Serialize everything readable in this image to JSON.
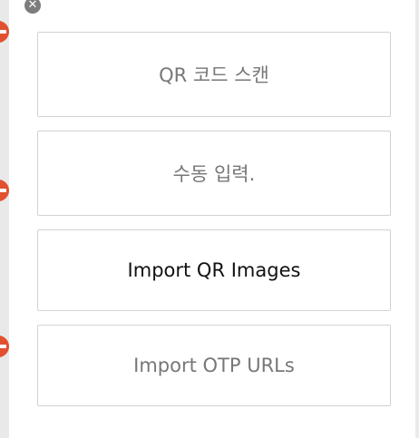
{
  "popup": {
    "close_icon": "close-icon",
    "menu": [
      {
        "label": "QR 코드 스캔",
        "color": "#777777"
      },
      {
        "label": "수동 입력.",
        "color": "#777777"
      },
      {
        "label": "Import QR Images",
        "color": "#111111"
      },
      {
        "label": "Import OTP URLs",
        "color": "#777777"
      }
    ]
  },
  "background": {
    "remove_icon": "remove-icon",
    "remove_color": "#e2512f"
  }
}
